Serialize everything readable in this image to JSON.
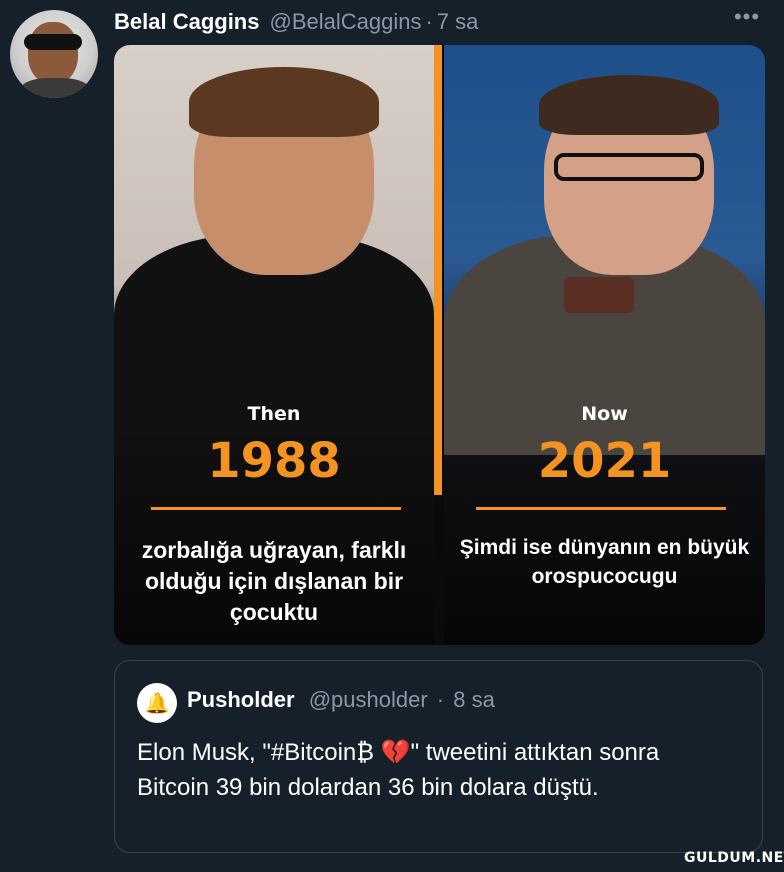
{
  "tweet": {
    "author_name": "Belal Caggins",
    "author_handle": "@BelalCaggins",
    "separator": "·",
    "time": "7 sa",
    "more_label": "•••"
  },
  "media": {
    "left": {
      "label": "Then",
      "year": "1988",
      "caption": "zorbalığa uğrayan, farklı olduğu için dışlanan bir çocuktu"
    },
    "right": {
      "label": "Now",
      "year": "2021",
      "caption": "Şimdi ise dünyanın en büyük orospucocugu"
    },
    "accent_color": "#f39323"
  },
  "quoted_tweet": {
    "author_name": "Pusholder",
    "author_handle": "@pusholder",
    "separator": "·",
    "time": "8 sa",
    "avatar_icon": "bell-icon",
    "text": "Elon Musk, \"#Bitcoin₿ 💔\" tweetini attıktan sonra Bitcoin 39 bin dolardan 36 bin dolara düştü."
  },
  "watermark": "GULDUM.NET",
  "colors": {
    "background": "#15202b",
    "secondary_text": "#8899a6",
    "border": "#38444d"
  }
}
